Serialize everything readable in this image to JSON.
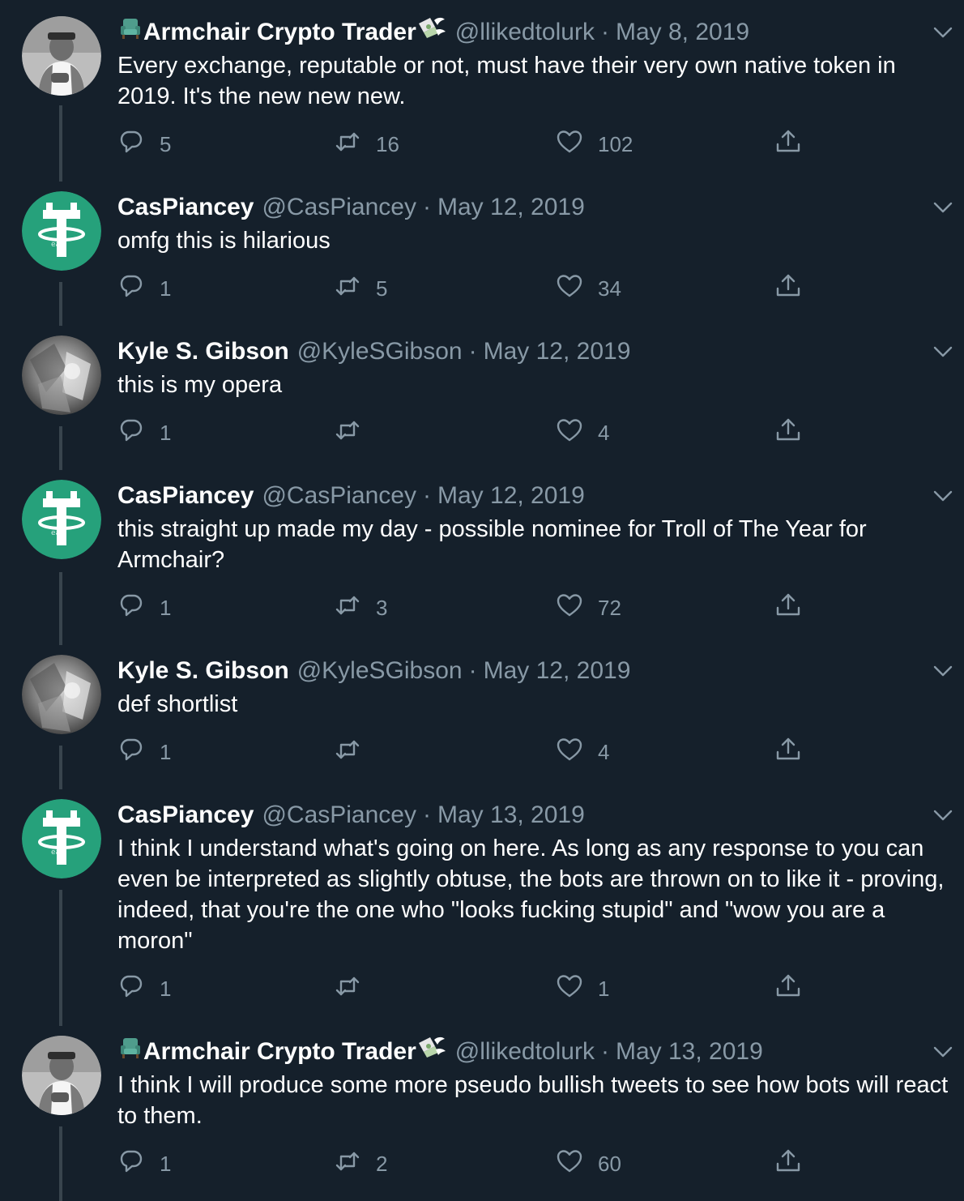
{
  "colors": {
    "background": "#15202b",
    "text_primary": "#ffffff",
    "text_secondary": "#8899a6",
    "thread_line": "#38444d",
    "tether_green": "#26a17b"
  },
  "icons": {
    "reply": "speech-bubble-icon",
    "retweet": "retweet-icon",
    "like": "heart-icon",
    "share": "share-upload-icon",
    "caret": "chevron-down-icon"
  },
  "tweets": [
    {
      "avatar": "armchair",
      "name_emoji_left": "armchair-emoji",
      "display_name": "Armchair Crypto Trader",
      "name_emoji_right": "money-with-wings-emoji",
      "handle": "@llikedtolurk",
      "separator": "·",
      "date": "May 8, 2019",
      "text": "Every exchange, reputable or not, must have their very own native token in 2019. It's the new new new.",
      "reply_count": "5",
      "retweet_count": "16",
      "like_count": "102"
    },
    {
      "avatar": "tether",
      "display_name": "CasPiancey",
      "handle": "@CasPiancey",
      "separator": "·",
      "date": "May 12, 2019",
      "text": "omfg this is hilarious",
      "reply_count": "1",
      "retweet_count": "5",
      "like_count": "34"
    },
    {
      "avatar": "kyle",
      "display_name": "Kyle S. Gibson",
      "handle": "@KyleSGibson",
      "separator": "·",
      "date": "May 12, 2019",
      "text": "this is my opera",
      "reply_count": "1",
      "retweet_count": "",
      "like_count": "4"
    },
    {
      "avatar": "tether",
      "display_name": "CasPiancey",
      "handle": "@CasPiancey",
      "separator": "·",
      "date": "May 12, 2019",
      "text": "this straight up made my day - possible nominee for Troll of The Year for Armchair?",
      "reply_count": "1",
      "retweet_count": "3",
      "like_count": "72"
    },
    {
      "avatar": "kyle",
      "display_name": "Kyle S. Gibson",
      "handle": "@KyleSGibson",
      "separator": "·",
      "date": "May 12, 2019",
      "text": "def shortlist",
      "reply_count": "1",
      "retweet_count": "",
      "like_count": "4"
    },
    {
      "avatar": "tether",
      "display_name": "CasPiancey",
      "handle": "@CasPiancey",
      "separator": "·",
      "date": "May 13, 2019",
      "text": "I think I understand what's going on here. As long as any response to you can even be interpreted as slightly obtuse, the bots are thrown on to like it - proving, indeed, that you're the one who \"looks fucking stupid\" and \"wow you are a moron\"",
      "reply_count": "1",
      "retweet_count": "",
      "like_count": "1"
    },
    {
      "avatar": "armchair",
      "name_emoji_left": "armchair-emoji",
      "display_name": "Armchair Crypto Trader",
      "name_emoji_right": "money-with-wings-emoji",
      "handle": "@llikedtolurk",
      "separator": "·",
      "date": "May 13, 2019",
      "text": "I think I will produce some more pseudo bullish tweets to see how bots will react to them.",
      "reply_count": "1",
      "retweet_count": "2",
      "like_count": "60"
    }
  ]
}
